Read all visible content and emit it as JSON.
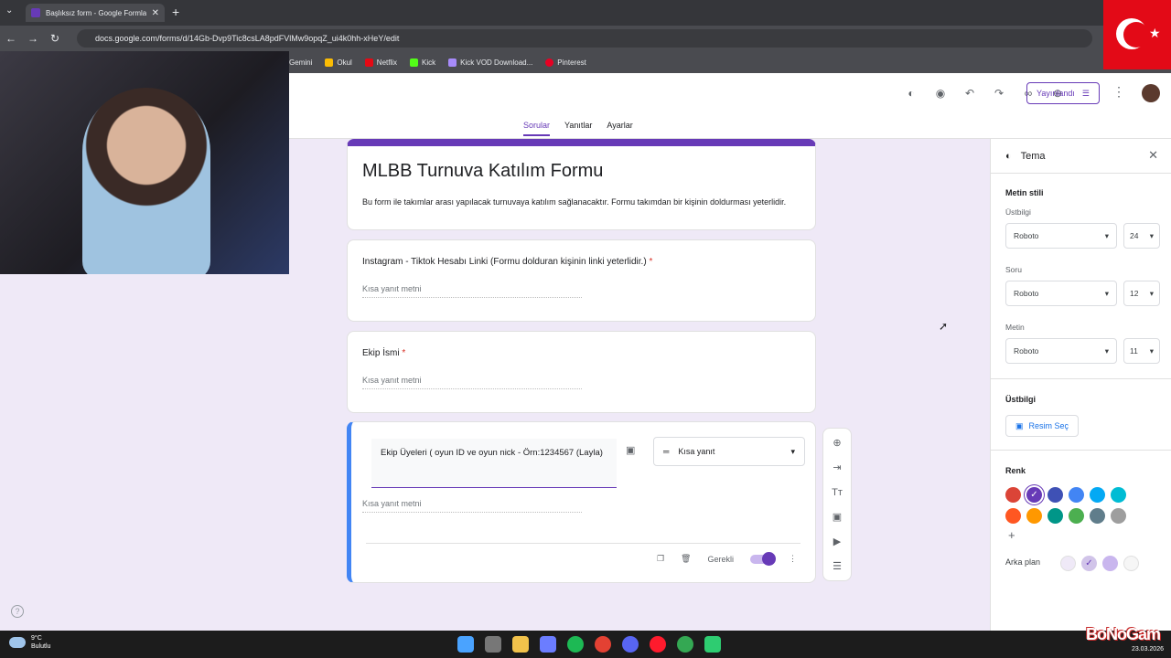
{
  "browser": {
    "tab_title": "Başlıksız form - Google Formlar",
    "url": "docs.google.com/forms/d/14Gb-Dvp9Tic8csLA8pdFVlMw9opqZ_ui4k0hh-xHeY/edit",
    "bookmarks": [
      {
        "label": "Gemini",
        "color": "#8ab4f8"
      },
      {
        "label": "Okul",
        "color": "#fbbc04"
      },
      {
        "label": "Netflix",
        "color": "#e50914"
      },
      {
        "label": "Kick",
        "color": "#53fc18"
      },
      {
        "label": "Kick VOD Download...",
        "color": "#a78bfa"
      },
      {
        "label": "Pinterest",
        "color": "#e60023"
      }
    ]
  },
  "topbar": {
    "publish_label": "Yayınlandı",
    "tabs": [
      "Sorular",
      "Yanıtlar",
      "Ayarlar"
    ],
    "icons": [
      "palette-icon",
      "preview-icon",
      "undo-icon",
      "redo-icon",
      "link-icon",
      "add-collaborator-icon"
    ]
  },
  "form": {
    "title": "MLBB Turnuva Katılım Formu",
    "description": "Bu form ile takımlar arası yapılacak turnuvaya katılım sağlanacaktır. Formu takımdan bir kişinin doldurması yeterlidir.",
    "questions": [
      {
        "title": "Instagram - Tiktok Hesabı Linki (Formu dolduran kişinin linki yeterlidir.)",
        "required": "*",
        "placeholder": "Kısa yanıt metni"
      },
      {
        "title": "Ekip İsmi",
        "required": "*",
        "placeholder": "Kısa yanıt metni"
      },
      {
        "title": "Ekip Üyeleri ( oyun ID ve oyun nick - Örn:1234567 (Layla)",
        "placeholder": "Kısa yanıt metni",
        "type": "Kısa yanıt",
        "required_label": "Gerekli",
        "required_on": true
      }
    ]
  },
  "theme": {
    "title": "Tema",
    "text_style": "Metin stili",
    "header_label": "Üstbilgi",
    "header_font": "Roboto",
    "header_size": "24",
    "question_label": "Soru",
    "question_font": "Roboto",
    "question_size": "12",
    "text_label": "Metin",
    "text_font": "Roboto",
    "text_size": "11",
    "header_section": "Üstbilgi",
    "image_button": "Resim Seç",
    "color_label": "Renk",
    "colors_row1": [
      "#db4437",
      "#673ab7",
      "#3f51b5",
      "#4285f4",
      "#03a9f4",
      "#00bcd4"
    ],
    "colors_row2": [
      "#ff5722",
      "#ff9800",
      "#009688",
      "#4caf50",
      "#607d8b",
      "#9e9e9e"
    ],
    "selected_color": "#673ab7",
    "bg_label": "Arka plan",
    "bg_colors": [
      "#efe9f7",
      "#d1c4e9",
      "#c9b6ee",
      "#f6f6f6"
    ],
    "selected_bg": "#d1c4e9"
  },
  "taskbar": {
    "temp": "9°C",
    "weather": "Bulutlu",
    "date": "23.03.2026"
  },
  "watermark": "BoNoGam"
}
